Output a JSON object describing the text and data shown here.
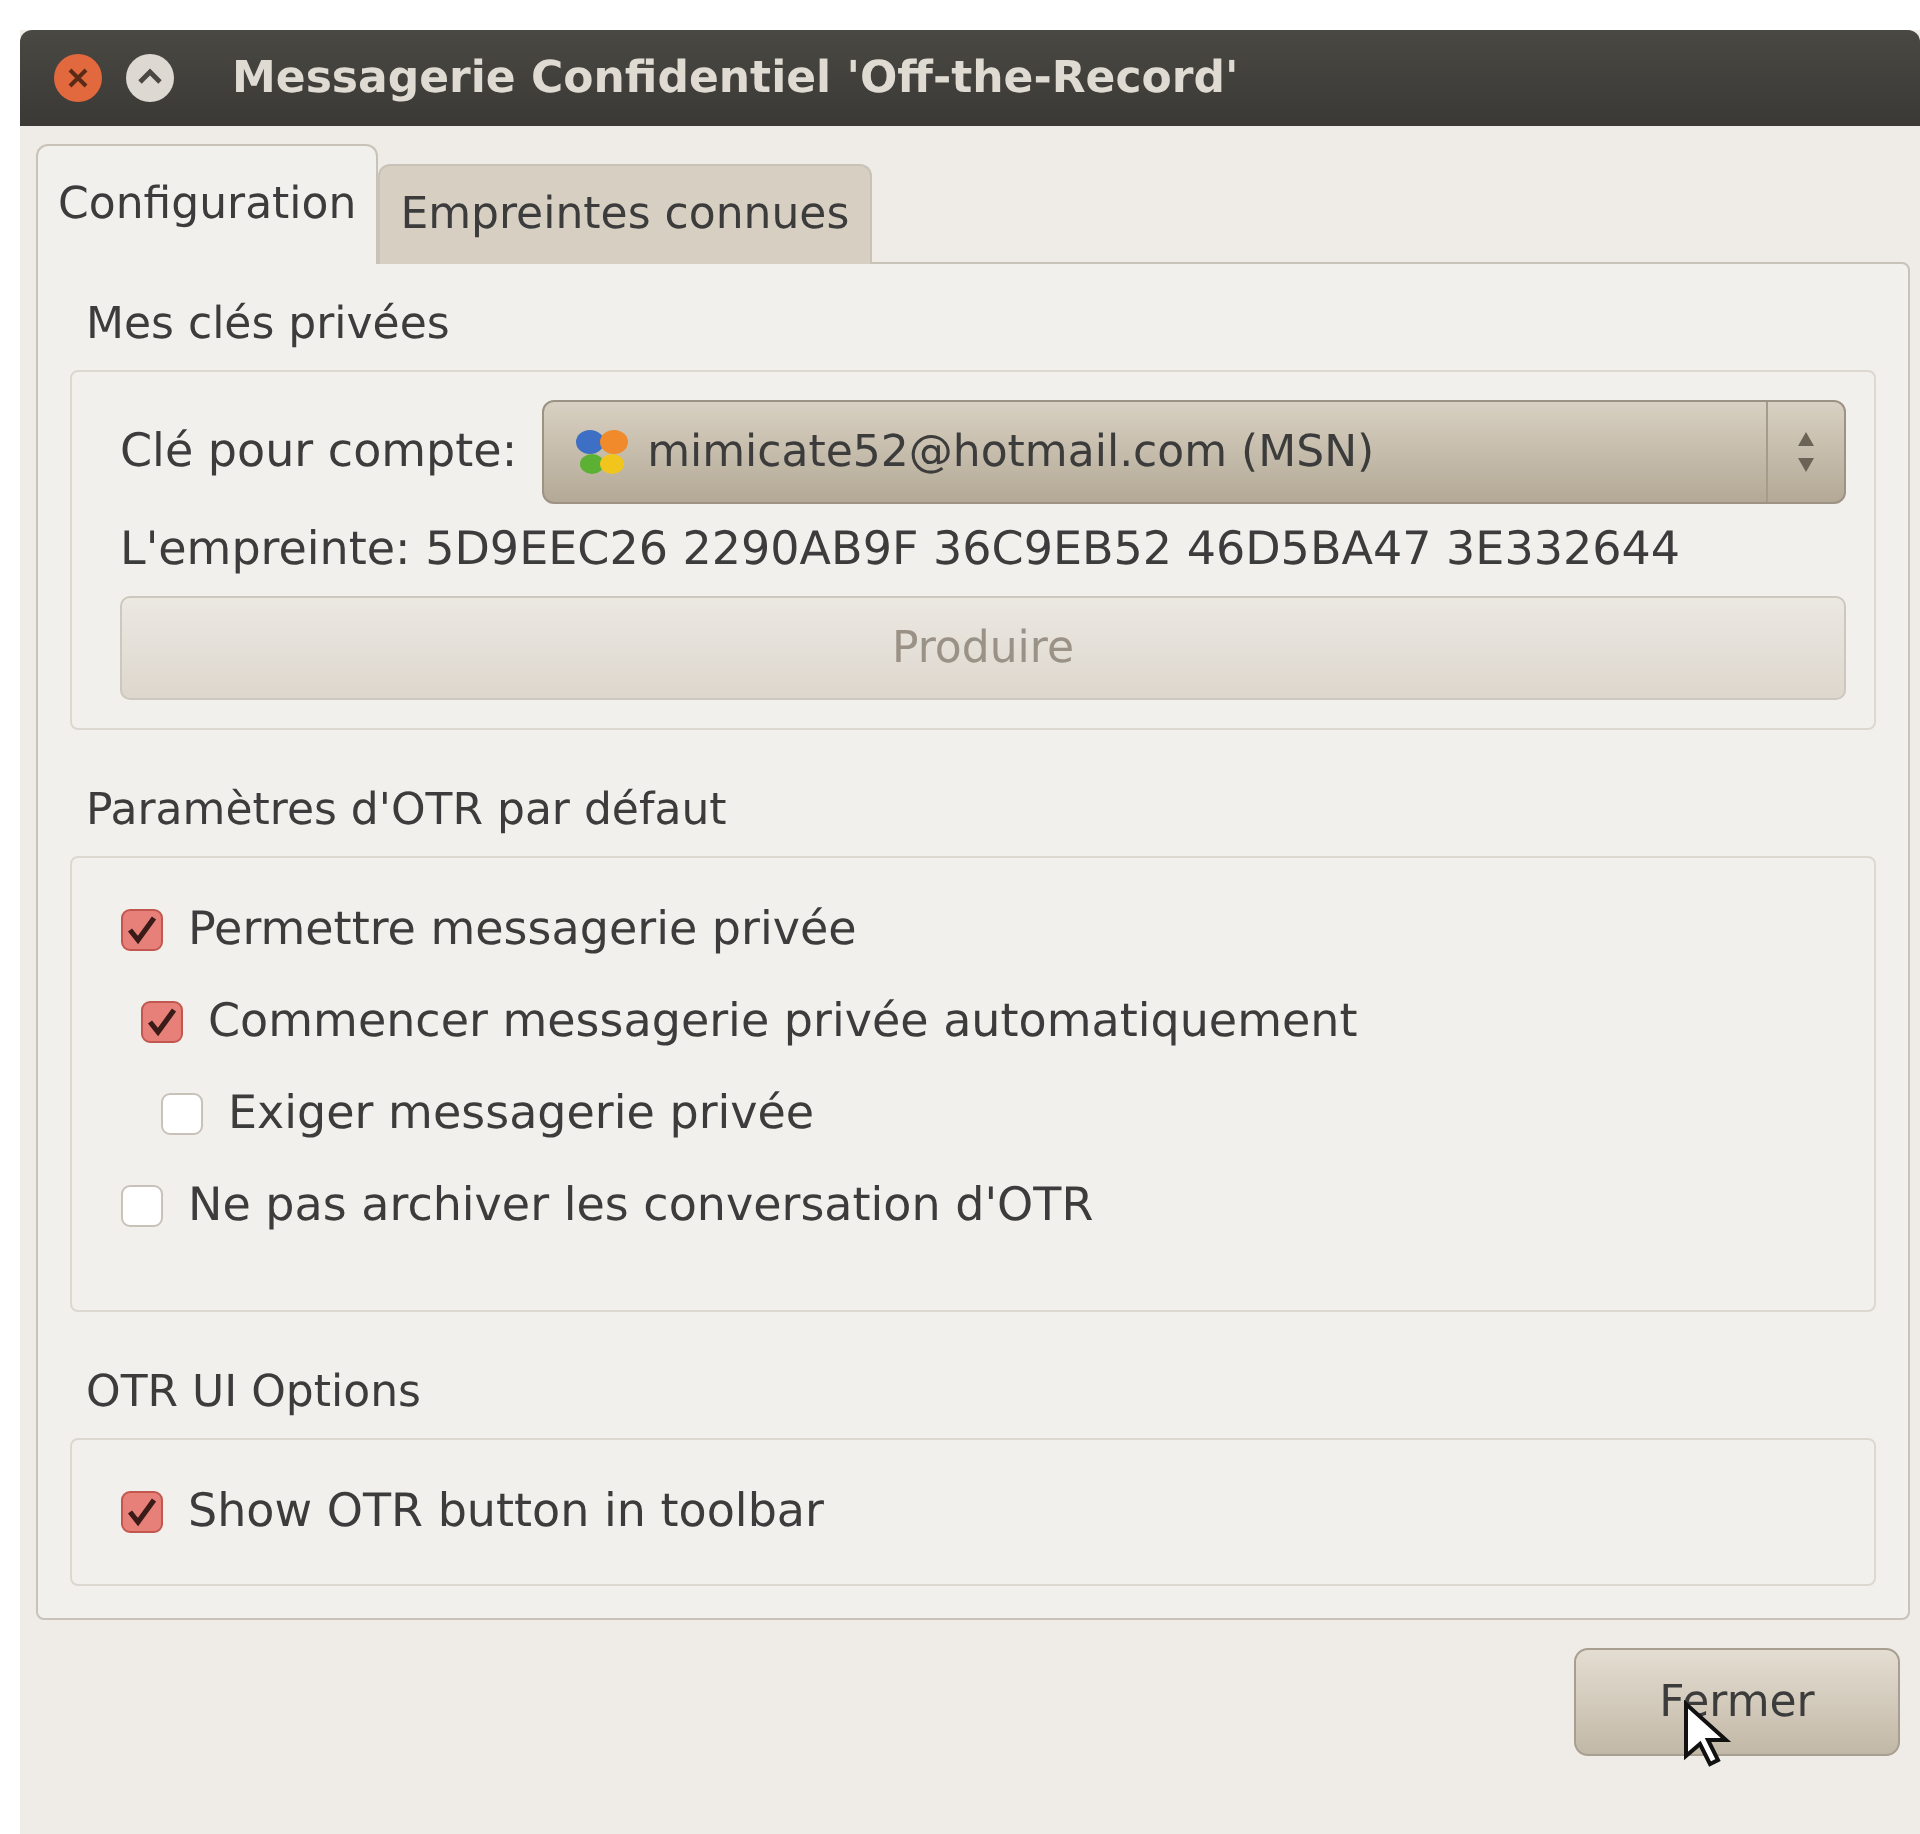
{
  "window": {
    "title": "Messagerie Confidentiel 'Off-the-Record'"
  },
  "tabs": [
    {
      "label": "Configuration",
      "selected": true
    },
    {
      "label": "Empreintes connues",
      "selected": false
    }
  ],
  "private_keys": {
    "title": "Mes clés privées",
    "account_label": "Clé pour compte:",
    "account_value": "mimicate52@hotmail.com (MSN)",
    "fingerprint": "L'empreinte: 5D9EEC26 2290AB9F 36C9EB52 46D5BA47 3E332644",
    "generate_button": {
      "label": "Produire",
      "disabled": true
    }
  },
  "default_settings": {
    "title": "Paramètres d'OTR par défaut",
    "options": [
      {
        "label": "Permettre messagerie privée",
        "checked": true,
        "children": [
          {
            "label": "Commencer messagerie privée automatiquement",
            "checked": true,
            "children": [
              {
                "label": "Exiger messagerie privée",
                "checked": false
              }
            ]
          }
        ]
      },
      {
        "label": "Ne pas archiver les conversation d'OTR",
        "checked": false
      }
    ]
  },
  "ui_options": {
    "title": "OTR UI Options",
    "options": [
      {
        "label": "Show OTR button in toolbar",
        "checked": true
      }
    ]
  },
  "buttons": [
    {
      "label": "Fermer"
    }
  ]
}
